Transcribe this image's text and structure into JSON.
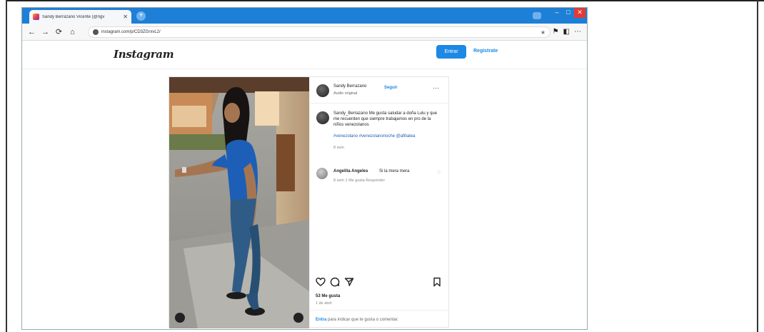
{
  "browser": {
    "tab_title": "Sandy Berrazano Vicente (@ngv",
    "tab_close": "✕",
    "new_tab": "+",
    "url": "instagram.com/p/CD3ZGrxvL2/",
    "nav": {
      "back": "←",
      "forward": "→",
      "reload": "⟳",
      "home": "⌂"
    },
    "window": {
      "minimize": "–",
      "maximize": "□",
      "close": "✕"
    },
    "toolbar_icons": [
      "★",
      "⚑",
      "◧",
      "⋯"
    ]
  },
  "instagram": {
    "logo": "Instagram",
    "login_label": "Entrar",
    "register_label": "Regístrate"
  },
  "post": {
    "author": "Sandy Berrazano",
    "follow": "Seguir",
    "author_sub": "Audio original",
    "more": "···",
    "caption": "Sandy_Berrazano Me gusta saludar a doña Lulu y que me recuerden que siempre trabajamos en pro de la niños venezolanos",
    "hashtags": "#venezolano #venezolanonoche @afiliatea",
    "caption_time": "8 sem",
    "comment_user": "Angelita Angeles",
    "comment_text": "Si la mera mera",
    "comment_meta": "8 sem    1 Me gusta    Responder",
    "comment_heart": "♡",
    "likes": "53 Me gusta",
    "date": "1 de abril",
    "login_prompt_link": "Entra",
    "login_prompt_rest": " para indicar que te gusta o comentar."
  },
  "icons": [
    "like-icon",
    "comment-icon",
    "share-icon",
    "save-icon",
    "lock-icon"
  ],
  "colors": {
    "browser_accent": "#1e7fd6",
    "instagram_blue": "#1e88e5"
  }
}
